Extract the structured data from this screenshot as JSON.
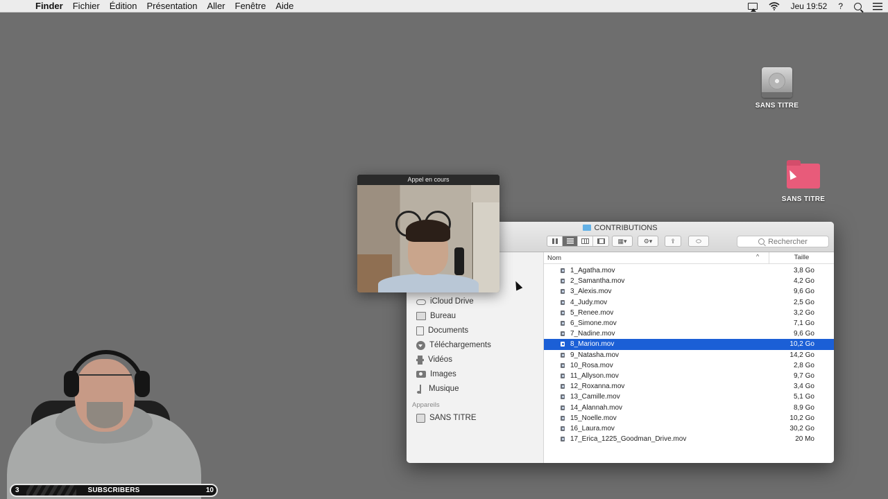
{
  "menubar": {
    "app_name": "Finder",
    "menus": [
      "Fichier",
      "Édition",
      "Présentation",
      "Aller",
      "Fenêtre",
      "Aide"
    ],
    "clock": "Jeu 19:52",
    "help": "?"
  },
  "desktop": {
    "drive_label": "SANS TITRE",
    "folder_label": "SANS TITRE",
    "folder_color": "#e85b7a"
  },
  "call": {
    "title": "Appel en cours"
  },
  "finder": {
    "window_title": "CONTRIBUTIONS",
    "search_placeholder": "Rechercher",
    "sidebar": {
      "favorites": [
        {
          "label": "iCloud Drive",
          "icon": "cloud-icon"
        },
        {
          "label": "Bureau",
          "icon": "desktop-icon"
        },
        {
          "label": "Documents",
          "icon": "document-icon"
        },
        {
          "label": "Téléchargements",
          "icon": "download-icon"
        },
        {
          "label": "Vidéos",
          "icon": "film-icon"
        },
        {
          "label": "Images",
          "icon": "camera-icon"
        },
        {
          "label": "Musique",
          "icon": "music-note-icon"
        }
      ],
      "devices_header": "Appareils",
      "devices": [
        {
          "label": "SANS TITRE",
          "icon": "disk-icon"
        }
      ]
    },
    "columns": {
      "name": "Nom",
      "size": "Taille",
      "sort_indicator": "^"
    },
    "selected_index": 7,
    "selection_color": "#1b5fd6",
    "files": [
      {
        "name": "1_Agatha.mov",
        "size": "3,8 Go"
      },
      {
        "name": "2_Samantha.mov",
        "size": "4,2 Go"
      },
      {
        "name": "3_Alexis.mov",
        "size": "9,6 Go"
      },
      {
        "name": "4_Judy.mov",
        "size": "2,5 Go"
      },
      {
        "name": "5_Renee.mov",
        "size": "3,2 Go"
      },
      {
        "name": "6_Simone.mov",
        "size": "7,1 Go"
      },
      {
        "name": "7_Nadine.mov",
        "size": "9,6 Go"
      },
      {
        "name": "8_Marion.mov",
        "size": "10,2 Go"
      },
      {
        "name": "9_Natasha.mov",
        "size": "14,2 Go"
      },
      {
        "name": "10_Rosa.mov",
        "size": "2,8 Go"
      },
      {
        "name": "11_Allyson.mov",
        "size": "9,7 Go"
      },
      {
        "name": "12_Roxanna.mov",
        "size": "3,4 Go"
      },
      {
        "name": "13_Camille.mov",
        "size": "5,1 Go"
      },
      {
        "name": "14_Alannah.mov",
        "size": "8,9 Go"
      },
      {
        "name": "15_Noelle.mov",
        "size": "10,2 Go"
      },
      {
        "name": "16_Laura.mov",
        "size": "30,2 Go"
      },
      {
        "name": "17_Erica_1225_Goodman_Drive.mov",
        "size": "20 Mo"
      }
    ]
  },
  "overlay": {
    "subscribers_label": "SUBSCRIBERS",
    "count_left": "3",
    "count_right": "10"
  }
}
